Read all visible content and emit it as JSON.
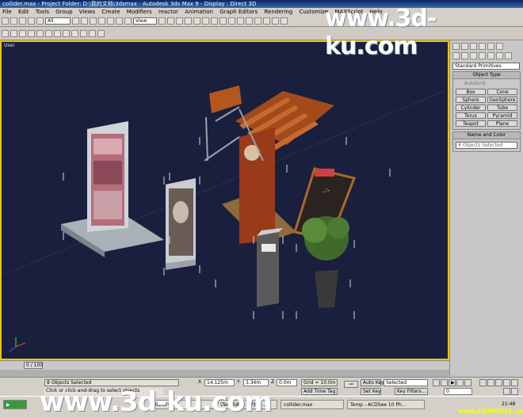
{
  "window": {
    "title": "collider.max   - Project Folder: D:\\我的文档\\3dsmax   - Autodesk 3ds Max 9   - Display : Direct 3D"
  },
  "menu": [
    "File",
    "Edit",
    "Tools",
    "Group",
    "Views",
    "Create",
    "Modifiers",
    "reactor",
    "Animation",
    "Graph Editors",
    "Rendering",
    "Customize",
    "MAXScript",
    "Help"
  ],
  "toolbar": {
    "selection_filter": "All",
    "ref_coord": "View"
  },
  "viewport": {
    "label": "User"
  },
  "command_panel": {
    "category": "Standard Primitives",
    "object_type_header": "Object Type",
    "autogrid_label": "AutoGrid",
    "buttons": [
      "Box",
      "Cone",
      "Sphere",
      "GeoSphere",
      "Cylinder",
      "Tube",
      "Torus",
      "Pyramid",
      "Teapot",
      "Plane"
    ],
    "name_color_header": "Name and Color",
    "name_value": "8 Objects Selected"
  },
  "timeline": {
    "frame": "0 / 100"
  },
  "status": {
    "selected": "8 Objects Selected",
    "prompt": "Click or click-and-drag to select objects",
    "x_label": "X",
    "x_value": "14.125m",
    "y_label": "Y",
    "y_value": "3.34m",
    "z_label": "Z",
    "z_value": "0.0m",
    "grid": "Grid = 10.0m",
    "add_time_tag": "Add Time Tag",
    "auto_key": "Auto Key",
    "set_key": "Set Key",
    "key_mode": "Selected",
    "key_filters": "Key Filters...",
    "frame_field": "0"
  },
  "taskbar": {
    "tasks": [
      "\\library\\...",
      "\\Temp\\画牛系列-男...",
      "collider.max",
      "Temp - ACDSee 10 Ph..."
    ],
    "clock": "21:48"
  },
  "watermarks": {
    "top": "www.3d-ku.com",
    "bottom": "www.3d-ku.com",
    "corner": "www.CGMODEL.cn"
  }
}
